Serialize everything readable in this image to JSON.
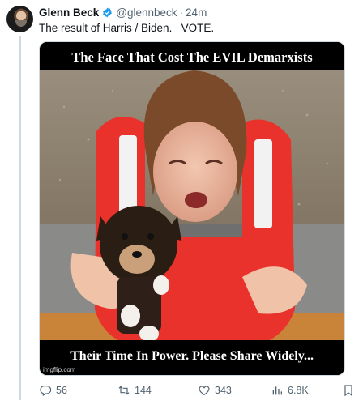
{
  "tweet": {
    "author_name": "Glenn Beck",
    "handle": "@glennbeck",
    "separator": "·",
    "time": "24m",
    "text": "The result of Harris / Biden.   VOTE."
  },
  "media": {
    "top_caption": "The Face That Cost The EVIL Demarxists",
    "bottom_caption": "Their Time In Power.  Please Share Widely...",
    "watermark": "imgflip.com"
  },
  "actions": {
    "replies": "56",
    "reposts": "144",
    "likes": "343",
    "views": "6.8K"
  },
  "colors": {
    "verified_badge": "#1d9bf0",
    "muted_text": "#536471",
    "life_vest": "#e8322b"
  }
}
